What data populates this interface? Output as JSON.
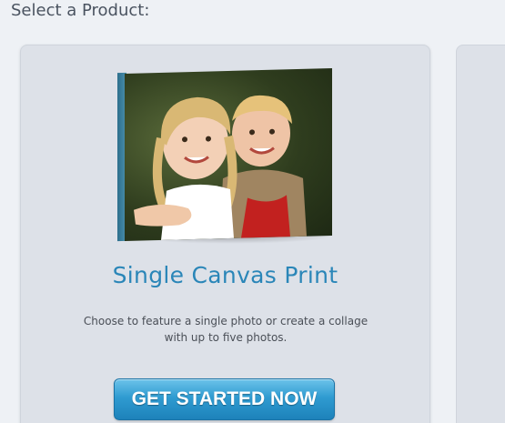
{
  "page": {
    "title": "Select a Product:"
  },
  "product_card": {
    "image_alt": "single-canvas-print-image",
    "title": "Single Canvas Print",
    "description": "Choose to feature a single photo or create a collage with up to five photos.",
    "cta_label": "GET STARTED NOW"
  },
  "colors": {
    "title_color": "#2a86b8",
    "cta_color": "#2f9bd1",
    "card_bg": "#dde1e8",
    "page_bg": "#eef1f5"
  }
}
